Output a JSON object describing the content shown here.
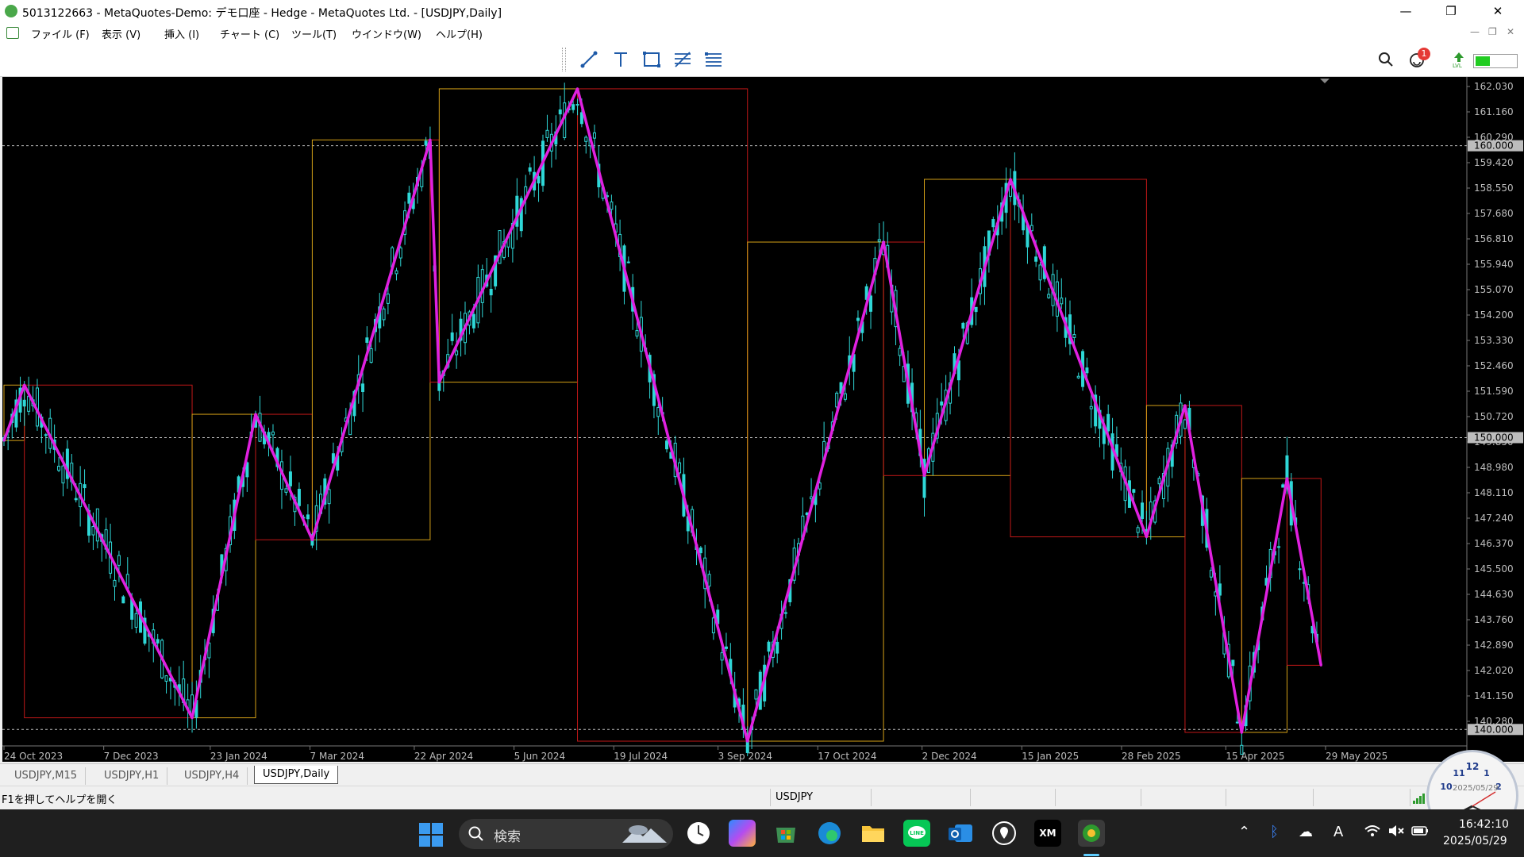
{
  "window": {
    "title": "5013122663 - MetaQuotes-Demo: デモ口座 - Hedge - MetaQuotes Ltd. - [USDJPY,Daily]",
    "controls": {
      "minimize": "—",
      "restore": "❐",
      "close": "✕"
    }
  },
  "menu": [
    "ファイル (F)",
    "表示 (V)",
    "挿入 (I)",
    "チャート (C)",
    "ツール(T)",
    "ウインドウ(W)",
    "ヘルプ(H)"
  ],
  "toolbar": {
    "tools": [
      "trendline-tool",
      "text-tool",
      "rectangle-tool",
      "fibonacci-tool",
      "equidistant-channel-tool"
    ],
    "notification_count": "1"
  },
  "chart": {
    "symbol": "USDJPY",
    "timeframe": "Daily",
    "price_axis": [
      "162.030",
      "161.160",
      "160.290",
      "159.420",
      "158.550",
      "157.680",
      "156.810",
      "155.940",
      "155.070",
      "154.200",
      "153.330",
      "152.460",
      "151.590",
      "150.720",
      "149.850",
      "148.980",
      "148.110",
      "147.240",
      "146.370",
      "145.500",
      "144.630",
      "143.760",
      "142.890",
      "142.020",
      "141.150",
      "140.280"
    ],
    "level_labels": [
      "160.000",
      "150.000",
      "140.000"
    ],
    "date_axis": [
      "24 Oct 2023",
      "7 Dec 2023",
      "23 Jan 2024",
      "7 Mar 2024",
      "22 Apr 2024",
      "5 Jun 2024",
      "19 Jul 2024",
      "3 Sep 2024",
      "17 Oct 2024",
      "2 Dec 2024",
      "15 Jan 2025",
      "28 Feb 2025",
      "15 Apr 2025",
      "29 May 2025"
    ],
    "colors": {
      "background": "#000000",
      "candle": "#2fd7d7",
      "zigzag": "#e020e0",
      "box_up": "#d4a017",
      "box_down": "#c01818",
      "level_line": "#bdbdbd"
    },
    "zigzag_points": [
      {
        "date": "24 Oct 2023",
        "price": 149.9
      },
      {
        "date": "2 Nov 2023",
        "price": 151.8
      },
      {
        "date": "15 Jan 2024",
        "price": 140.4
      },
      {
        "date": "12 Feb 2024",
        "price": 150.8
      },
      {
        "date": "8 Mar 2024",
        "price": 146.5
      },
      {
        "date": "29 Apr 2024",
        "price": 160.2
      },
      {
        "date": "3 May 2024",
        "price": 151.9
      },
      {
        "date": "3 Jul 2024",
        "price": 161.95
      },
      {
        "date": "16 Sep 2024",
        "price": 139.6
      },
      {
        "date": "15 Nov 2024",
        "price": 156.7
      },
      {
        "date": "3 Dec 2024",
        "price": 148.7
      },
      {
        "date": "10 Jan 2025",
        "price": 158.85
      },
      {
        "date": "11 Mar 2025",
        "price": 146.6
      },
      {
        "date": "28 Mar 2025",
        "price": 151.1
      },
      {
        "date": "22 Apr 2025",
        "price": 139.9
      },
      {
        "date": "12 May 2025",
        "price": 148.6
      },
      {
        "date": "27 May 2025",
        "price": 142.2
      }
    ]
  },
  "tabs": [
    "USDJPY,M15",
    "USDJPY,H1",
    "USDJPY,H4",
    "USDJPY,Daily"
  ],
  "status": {
    "help": "F1を押してヘルプを開く",
    "symbol": "USDJPY"
  },
  "clock_widget": {
    "date": "2025/05/29"
  },
  "taskbar": {
    "search_placeholder": "検索",
    "time": "16:42:10",
    "date": "2025/05/29",
    "ime": "A"
  }
}
